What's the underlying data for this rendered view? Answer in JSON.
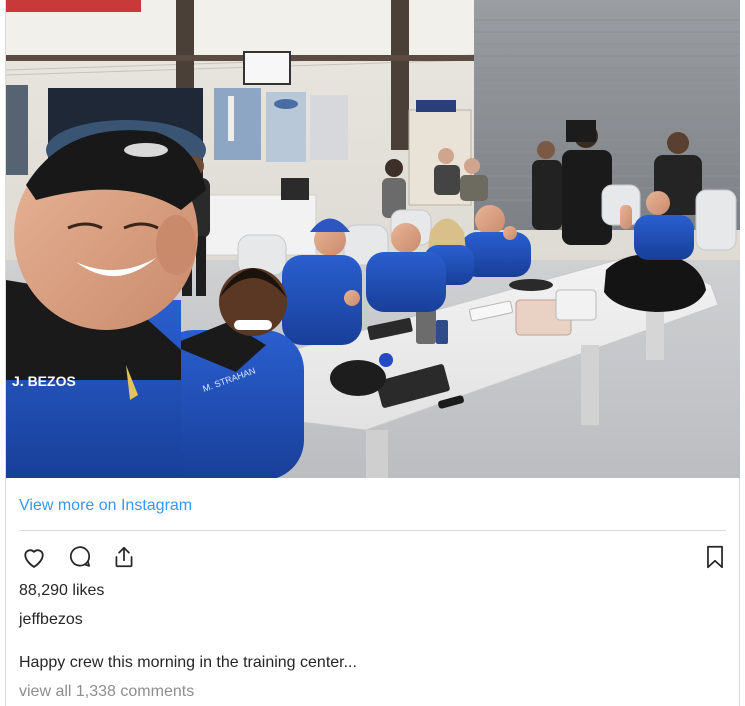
{
  "post": {
    "photo_alt": "",
    "suit_names": {
      "left": "J. BEZOS",
      "second": "M. STRAHAN"
    },
    "view_more_label": "View more on Instagram",
    "likes_text": "88,290 likes",
    "username": "jeffbezos",
    "caption": "Happy crew this morning in the training center...",
    "comments_link": "view all 1,338 comments"
  },
  "icons": {
    "like": "heart-outline-icon",
    "comment": "speech-bubble-icon",
    "share": "share-upload-icon",
    "save": "bookmark-outline-icon"
  },
  "colors": {
    "link_blue": "#3897f0",
    "text": "#262626",
    "muted": "#8e8e8e",
    "divider": "#dbdbdb",
    "flight_suit_blue": "#1f4fb8"
  }
}
